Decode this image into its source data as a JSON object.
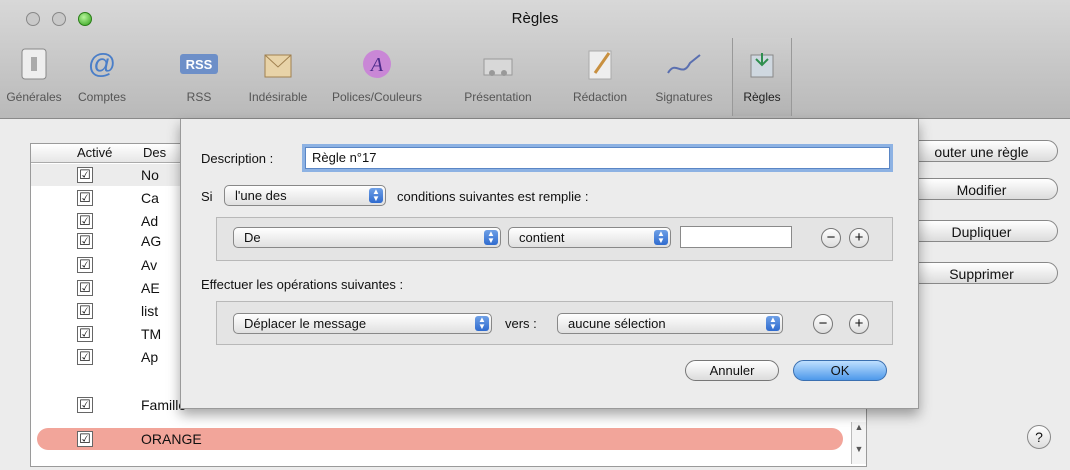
{
  "window": {
    "title": "Règles"
  },
  "toolbar": {
    "items": [
      {
        "label": "Générales",
        "icon": "switch-icon"
      },
      {
        "label": "Comptes",
        "icon": "at-icon"
      },
      {
        "label": "RSS",
        "icon": "rss-icon"
      },
      {
        "label": "Indésirable",
        "icon": "junk-mail-icon"
      },
      {
        "label": "Polices/Couleurs",
        "icon": "fonts-icon"
      },
      {
        "label": "Présentation",
        "icon": "viewing-icon"
      },
      {
        "label": "Rédaction",
        "icon": "composing-icon"
      },
      {
        "label": "Signatures",
        "icon": "signature-icon"
      },
      {
        "label": "Règles",
        "icon": "rules-icon"
      }
    ]
  },
  "rules_table": {
    "col_active": "Activé",
    "col_description": "Des",
    "rows": [
      {
        "name": "No",
        "checked": "☑"
      },
      {
        "name": "Ca",
        "checked": "☑"
      },
      {
        "name": "Ad",
        "checked": "☑"
      },
      {
        "name": "AG",
        "checked": "☑"
      },
      {
        "name": "Av",
        "checked": "☑"
      },
      {
        "name": "AE",
        "checked": "☑"
      },
      {
        "name": "list",
        "checked": "☑"
      },
      {
        "name": "TM",
        "checked": "☑"
      },
      {
        "name": "Ap",
        "checked": "☑"
      },
      {
        "name": "Famille",
        "checked": "☑"
      },
      {
        "name": "ORANGE",
        "checked": "☑"
      }
    ]
  },
  "side_buttons": {
    "add": "outer une règle",
    "edit": "Modifier",
    "duplicate": "Dupliquer",
    "delete": "Supprimer"
  },
  "help": {
    "label": "?"
  },
  "sheet": {
    "description_label": "Description :",
    "description_value": "Règle n°17",
    "if_label": "Si",
    "match_popup": "l'une des",
    "match_suffix": "conditions suivantes est remplie :",
    "condition": {
      "field": "De",
      "operator": "contient",
      "value": ""
    },
    "actions_label": "Effectuer les opérations suivantes :",
    "action": {
      "type": "Déplacer le message",
      "to_label": "vers :",
      "target": "aucune sélection"
    },
    "minus": "−",
    "plus": "+",
    "cancel": "Annuler",
    "ok": "OK"
  }
}
